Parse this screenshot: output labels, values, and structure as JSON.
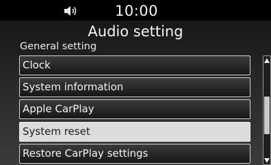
{
  "status_bar": {
    "volume_icon": "speaker-volume-icon",
    "time": "10:00"
  },
  "header": {
    "title": "Audio setting"
  },
  "section": {
    "heading": "General setting"
  },
  "menu": {
    "items": [
      {
        "label": "Clock"
      },
      {
        "label": "System information"
      },
      {
        "label": "Apple CarPlay"
      },
      {
        "label": "System reset",
        "selected": true
      },
      {
        "label": "Restore CarPlay settings"
      }
    ]
  },
  "scrollbar": {
    "position_fraction": 0.58,
    "visible_fraction": 0.42
  },
  "colors": {
    "selected_background": "#dcdcdc",
    "item_border": "#d6d6d6",
    "text": "#f4f4f4"
  }
}
